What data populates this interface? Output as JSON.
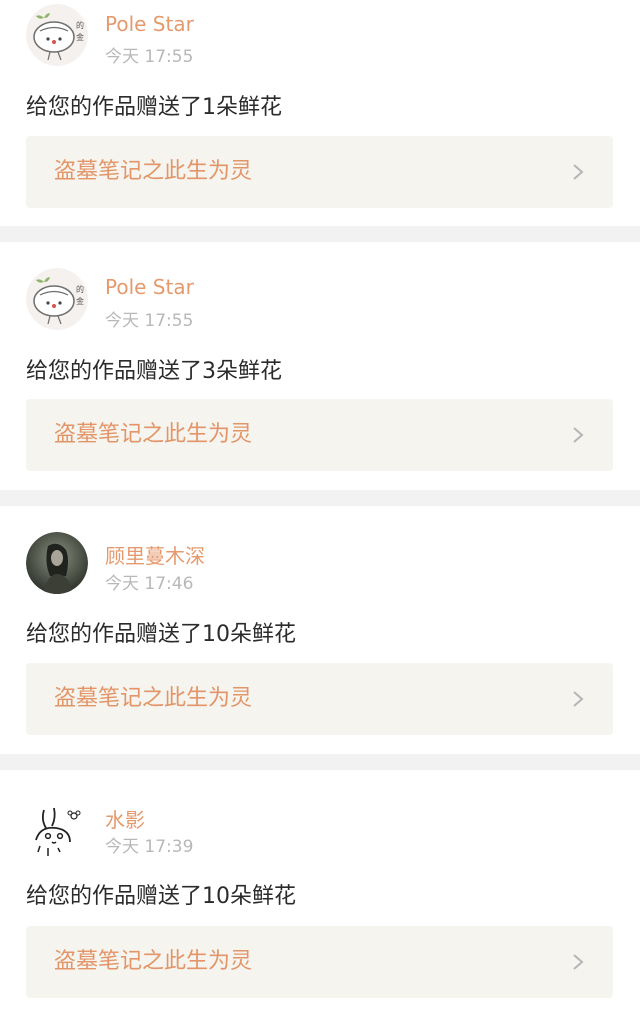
{
  "notifications": [
    {
      "username": "Pole Star",
      "timestamp": "今天 17:55",
      "message": "给您的作品赠送了1朵鲜花",
      "work_title": "盗墓笔记之此生为灵",
      "avatar": "cartoon-bun-avatar"
    },
    {
      "username": "Pole Star",
      "timestamp": "今天 17:55",
      "message": "给您的作品赠送了3朵鲜花",
      "work_title": "盗墓笔记之此生为灵",
      "avatar": "cartoon-bun-avatar"
    },
    {
      "username": "顾里蔓木深",
      "timestamp": "今天 17:46",
      "message": "给您的作品赠送了10朵鲜花",
      "work_title": "盗墓笔记之此生为灵",
      "avatar": "dark-photo-avatar"
    },
    {
      "username": "水影",
      "timestamp": "今天 17:39",
      "message": "给您的作品赠送了10朵鲜花",
      "work_title": "盗墓笔记之此生为灵",
      "avatar": "line-drawing-bunny-avatar"
    }
  ],
  "colors": {
    "username": "#e59a6e",
    "work_title": "#e39568",
    "timestamp": "#b8b8b8",
    "link_background": "#f5f4ef",
    "separator": "#f2f2f2"
  },
  "icons": {
    "chevron": "chevron-right-icon"
  }
}
